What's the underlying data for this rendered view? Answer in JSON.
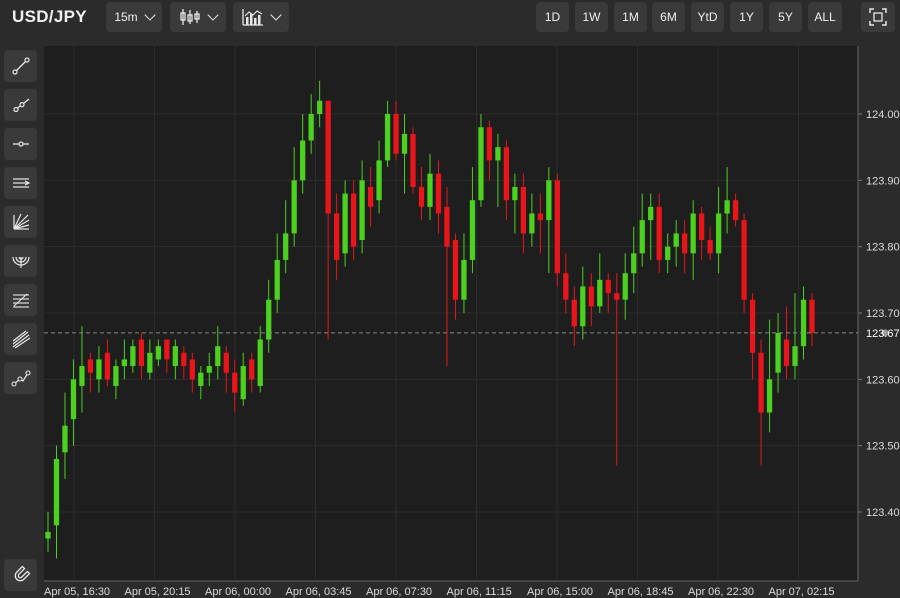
{
  "header": {
    "symbol": "USD/JPY",
    "interval": "15m",
    "chart_type_icon": "candlestick-icon",
    "indicators_icon": "indicators-icon",
    "ranges": [
      "1D",
      "1W",
      "1M",
      "6M",
      "YtD",
      "1Y",
      "5Y",
      "ALL"
    ],
    "fullscreen_icon": "fullscreen-icon"
  },
  "tools": [
    "trend-line-icon",
    "ray-icon",
    "horizontal-line-icon",
    "parallel-channel-icon",
    "fib-fan-icon",
    "fib-arc-icon",
    "fib-retracement-icon",
    "pitchfork-icon",
    "path-icon",
    "magnet-icon"
  ],
  "colors": {
    "up": "#4cd11f",
    "down": "#e8151b",
    "background": "#1e1e1e",
    "grid": "#2c2c2c",
    "crosshair": "#888888"
  },
  "chart_data": {
    "type": "candlestick",
    "y_ticks": [
      "124.00",
      "123.90",
      "123.80",
      "123.70",
      "123.60",
      "123.50",
      "123.40"
    ],
    "x_ticks": [
      "Apr 05, 16:30",
      "Apr 05, 20:15",
      "Apr 06, 00:00",
      "Apr 06, 03:45",
      "Apr 06, 07:30",
      "Apr 06, 11:15",
      "Apr 06, 15:00",
      "Apr 06, 18:45",
      "Apr 06, 22:30",
      "Apr 07, 02:15"
    ],
    "ylim": [
      123.31,
      124.07
    ],
    "x_start": "Apr 05, 16:30",
    "current_price": "123.67",
    "closes": [
      123.37,
      123.48,
      123.53,
      123.6,
      123.62,
      123.61,
      123.63,
      123.6,
      123.62,
      123.63,
      123.65,
      123.62,
      123.64,
      123.65,
      123.63,
      123.65,
      123.62,
      123.6,
      123.61,
      123.62,
      123.65,
      123.61,
      123.58,
      123.62,
      123.6,
      123.66,
      123.72,
      123.78,
      123.82,
      123.9,
      123.96,
      124.0,
      124.02,
      123.85,
      123.78,
      123.88,
      123.8,
      123.9,
      123.86,
      123.93,
      124.0,
      123.94,
      123.97,
      123.89,
      123.86,
      123.91,
      123.85,
      123.8,
      123.72,
      123.78,
      123.87,
      123.98,
      123.93,
      123.95,
      123.87,
      123.89,
      123.82,
      123.85,
      123.84,
      123.9,
      123.76,
      123.72,
      123.68,
      123.74,
      123.71,
      123.75,
      123.73,
      123.72,
      123.76,
      123.79,
      123.84,
      123.86,
      123.78,
      123.8,
      123.82,
      123.79,
      123.85,
      123.81,
      123.79,
      123.85,
      123.87,
      123.84,
      123.72,
      123.64,
      123.55,
      123.6,
      123.67,
      123.62,
      123.65,
      123.72,
      123.67
    ],
    "opens": [
      123.36,
      123.38,
      123.49,
      123.54,
      123.59,
      123.63,
      123.6,
      123.64,
      123.59,
      123.62,
      123.62,
      123.66,
      123.61,
      123.63,
      123.66,
      123.62,
      123.64,
      123.63,
      123.59,
      123.61,
      123.62,
      123.64,
      123.61,
      123.57,
      123.63,
      123.59,
      123.66,
      123.72,
      123.78,
      123.82,
      123.9,
      123.96,
      124.0,
      124.02,
      123.85,
      123.79,
      123.88,
      123.81,
      123.89,
      123.87,
      123.93,
      124.0,
      123.94,
      123.97,
      123.89,
      123.86,
      123.91,
      123.86,
      123.81,
      123.72,
      123.78,
      123.87,
      123.98,
      123.93,
      123.95,
      123.87,
      123.89,
      123.82,
      123.85,
      123.84,
      123.9,
      123.76,
      123.72,
      123.68,
      123.74,
      123.71,
      123.75,
      123.73,
      123.72,
      123.76,
      123.79,
      123.84,
      123.86,
      123.78,
      123.8,
      123.82,
      123.79,
      123.85,
      123.81,
      123.79,
      123.85,
      123.87,
      123.84,
      123.72,
      123.64,
      123.55,
      123.61,
      123.66,
      123.62,
      123.65,
      123.72
    ],
    "highs": [
      123.4,
      123.5,
      123.58,
      123.63,
      123.68,
      123.64,
      123.65,
      123.66,
      123.63,
      123.66,
      123.66,
      123.67,
      123.66,
      123.66,
      123.66,
      123.66,
      123.65,
      123.64,
      123.62,
      123.64,
      123.68,
      123.65,
      123.63,
      123.64,
      123.64,
      123.68,
      123.75,
      123.82,
      123.87,
      123.95,
      124.0,
      124.03,
      124.05,
      124.02,
      123.88,
      123.9,
      123.9,
      123.93,
      123.92,
      123.96,
      124.02,
      124.02,
      124.0,
      123.98,
      123.92,
      123.94,
      123.93,
      123.89,
      123.82,
      123.82,
      123.92,
      124.0,
      123.99,
      123.97,
      123.96,
      123.91,
      123.91,
      123.88,
      123.88,
      123.92,
      123.91,
      123.79,
      123.74,
      123.77,
      123.76,
      123.79,
      123.76,
      123.76,
      123.79,
      123.83,
      123.88,
      123.88,
      123.88,
      123.82,
      123.84,
      123.84,
      123.87,
      123.86,
      123.83,
      123.89,
      123.92,
      123.88,
      123.85,
      123.73,
      123.66,
      123.69,
      123.7,
      123.71,
      123.73,
      123.74,
      123.73
    ],
    "lows": [
      123.34,
      123.33,
      123.45,
      123.5,
      123.55,
      123.58,
      123.58,
      123.59,
      123.57,
      123.6,
      123.61,
      123.6,
      123.6,
      123.62,
      123.61,
      123.6,
      123.6,
      123.58,
      123.57,
      123.59,
      123.6,
      123.58,
      123.55,
      123.56,
      123.58,
      123.58,
      123.64,
      123.7,
      123.76,
      123.8,
      123.88,
      123.94,
      123.98,
      123.66,
      123.75,
      123.77,
      123.78,
      123.79,
      123.83,
      123.85,
      123.92,
      123.93,
      123.88,
      123.88,
      123.84,
      123.84,
      123.82,
      123.62,
      123.69,
      123.7,
      123.76,
      123.86,
      123.9,
      123.86,
      123.84,
      123.82,
      123.79,
      123.8,
      123.79,
      123.76,
      123.74,
      123.7,
      123.65,
      123.66,
      123.68,
      123.7,
      123.7,
      123.47,
      123.69,
      123.73,
      123.77,
      123.78,
      123.76,
      123.76,
      123.77,
      123.76,
      123.75,
      123.78,
      123.78,
      123.76,
      123.82,
      123.83,
      123.7,
      123.6,
      123.47,
      123.52,
      123.58,
      123.6,
      123.6,
      123.63,
      123.65
    ]
  }
}
